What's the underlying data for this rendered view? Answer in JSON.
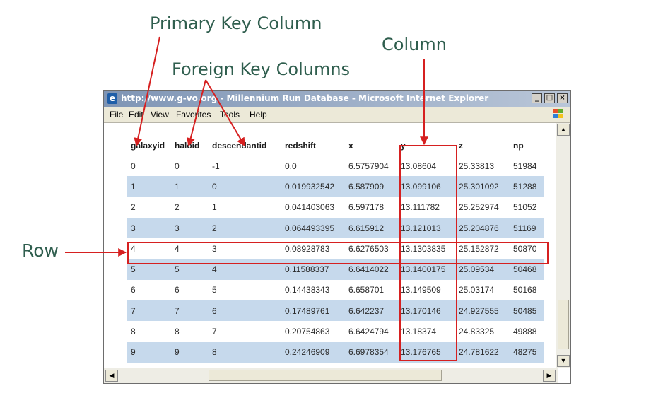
{
  "annotations": {
    "primary_key": "Primary Key Column",
    "column": "Column",
    "foreign_keys": "Foreign Key Columns",
    "row": "Row"
  },
  "annotation_color": "#d62020",
  "browser": {
    "title": "http://www.g-vo.org - Millennium Run Database - Microsoft Internet Explorer",
    "menu": [
      "File",
      "Edit",
      "View",
      "Favorites",
      "Tools",
      "Help"
    ]
  },
  "table": {
    "headers": [
      "galaxyid",
      "haloid",
      "descendantid",
      "redshift",
      "x",
      "y",
      "z",
      "np"
    ],
    "rows": [
      [
        "0",
        "0",
        "-1",
        "0.0",
        "6.5757904",
        "13.08604",
        "25.33813",
        "51984"
      ],
      [
        "1",
        "1",
        "0",
        "0.019932542",
        "6.587909",
        "13.099106",
        "25.301092",
        "51288"
      ],
      [
        "2",
        "2",
        "1",
        "0.041403063",
        "6.597178",
        "13.111782",
        "25.252974",
        "51052"
      ],
      [
        "3",
        "3",
        "2",
        "0.064493395",
        "6.615912",
        "13.121013",
        "25.204876",
        "51169"
      ],
      [
        "4",
        "4",
        "3",
        "0.08928783",
        "6.6276503",
        "13.1303835",
        "25.152872",
        "50870"
      ],
      [
        "5",
        "5",
        "4",
        "0.11588337",
        "6.6414022",
        "13.1400175",
        "25.09534",
        "50468"
      ],
      [
        "6",
        "6",
        "5",
        "0.14438343",
        "6.658701",
        "13.149509",
        "25.03174",
        "50168"
      ],
      [
        "7",
        "7",
        "6",
        "0.17489761",
        "6.642237",
        "13.170146",
        "24.927555",
        "50485"
      ],
      [
        "8",
        "8",
        "7",
        "0.20754863",
        "6.6424794",
        "13.18374",
        "24.83325",
        "49888"
      ],
      [
        "9",
        "9",
        "8",
        "0.24246909",
        "6.6978354",
        "13.176765",
        "24.781622",
        "48275"
      ]
    ]
  }
}
